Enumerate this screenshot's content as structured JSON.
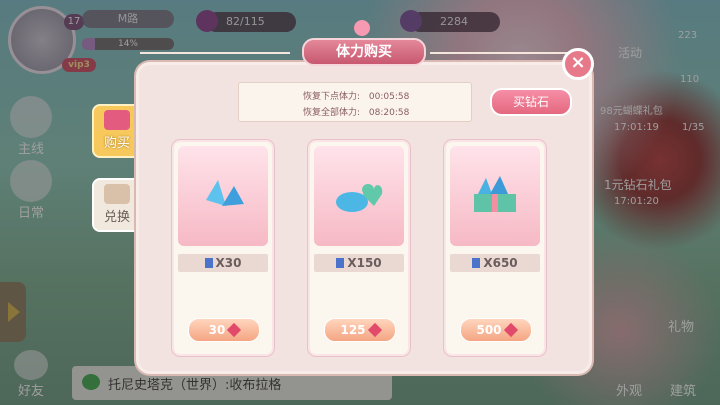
{
  "hud": {
    "level": "17",
    "name": "M路",
    "exp_percent": "14%",
    "exp_fraction": 0.14,
    "vip": "vip3",
    "stamina": "82/115",
    "currency": "2284",
    "right_counter": "223",
    "right_counter2": "110",
    "right_counter3": "1/35"
  },
  "left_menu": {
    "mainline": "主线",
    "daily": "日常",
    "friends": "好友"
  },
  "right_menu": {
    "activity": "活动",
    "gift_98": "98元蝴蝶礼包",
    "timer1": "17:01:19",
    "gift_1yuan": "1元钻石礼包",
    "timer2": "17:01:20",
    "gift": "礼物",
    "appearance": "外观",
    "building": "建筑"
  },
  "chat": {
    "text": "托尼史塔克（世界）:收布拉格"
  },
  "tabs": {
    "buy": "购买",
    "exchange": "兑换"
  },
  "panel": {
    "title": "体力购买",
    "recover_next_label": "恢复下点体力:",
    "recover_next_time": "00:05:58",
    "recover_all_label": "恢复全部体力:",
    "recover_all_time": "08:20:58",
    "buy_diamond": "买钻石",
    "close": "×",
    "cards": [
      {
        "qty": "X30",
        "price": "30"
      },
      {
        "qty": "X150",
        "price": "125"
      },
      {
        "qty": "X650",
        "price": "500"
      }
    ]
  },
  "colors": {
    "panel_bg": "#f2e3e0",
    "title_pink": "#d56b80",
    "gem_blue": "#4a73c9",
    "price_orange": "#f4a583"
  }
}
